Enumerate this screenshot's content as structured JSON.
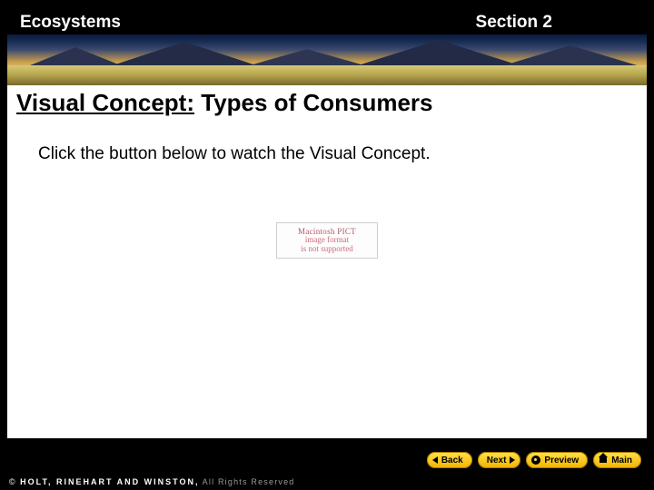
{
  "header": {
    "chapter": "Ecosystems",
    "section": "Section 2"
  },
  "title": {
    "prefix": "Visual Concept:",
    "rest": " Types of Consumers"
  },
  "body": {
    "instruction": "Click the button below to watch the Visual Concept."
  },
  "placeholder": {
    "line1": "Macintosh PICT",
    "line2": "image format",
    "line3": "is not supported"
  },
  "toolbar": {
    "back": "Back",
    "next": "Next",
    "preview": "Preview",
    "main": "Main"
  },
  "footer": {
    "brand": "HOLT, RINEHART AND WINSTON,",
    "rights": " All Rights Reserved"
  }
}
